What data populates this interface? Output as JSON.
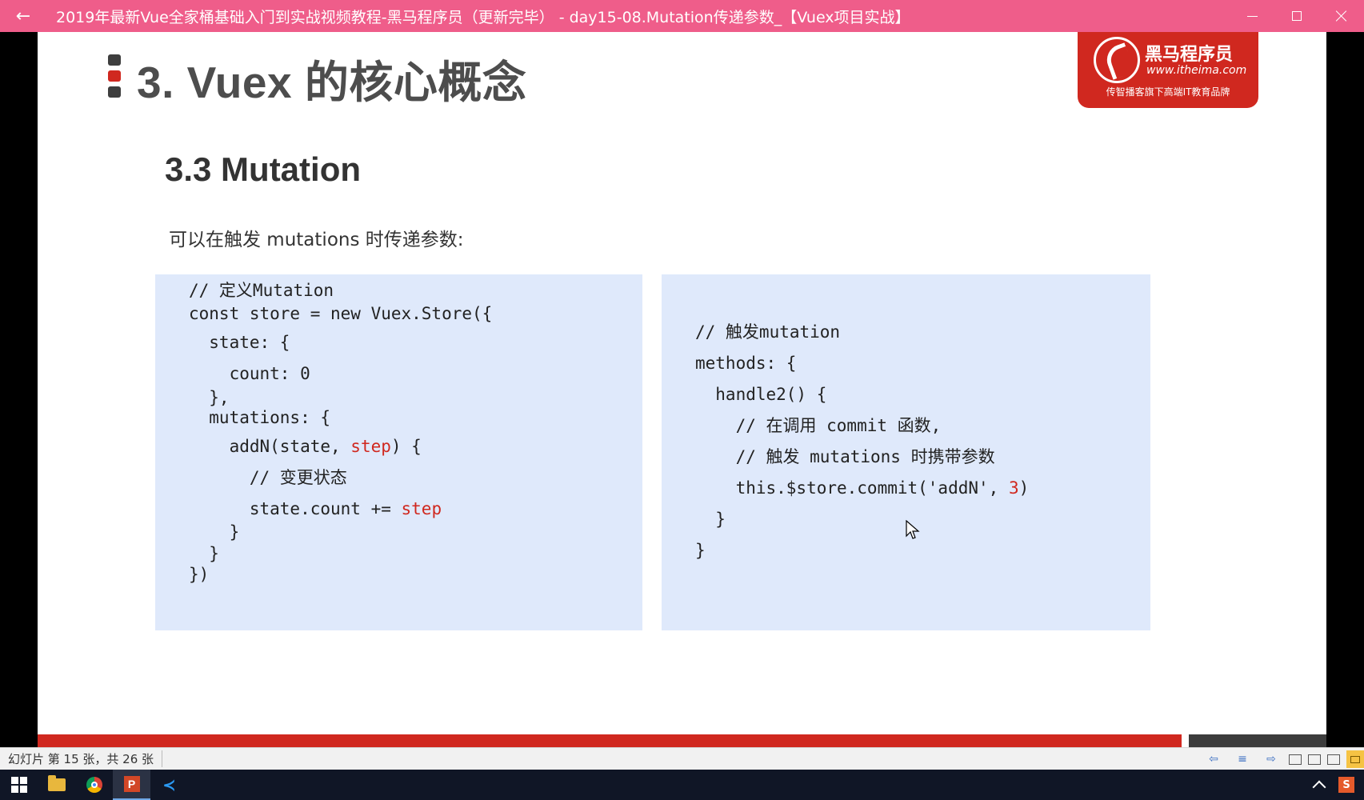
{
  "window": {
    "back_glyph": "←",
    "title": "2019年最新Vue全家桶基础入门到实战视频教程-黑马程序员（更新完毕） - day15-08.Mutation传递参数_【Vuex项目实战】",
    "accent_color": "#ef5d8a"
  },
  "slide": {
    "heading": "3. Vuex 的核心概念",
    "logo": {
      "name": "黑马程序员",
      "url": "www.itheima.com",
      "slogan": "传智播客旗下高端IT教育品牌"
    },
    "subtitle": "3.3 Mutation",
    "intro": "可以在触发 mutations 时传递参数:",
    "code_left": [
      "// 定义Mutation",
      "const store = new Vuex.Store({",
      "  state: {",
      "    count: 0",
      "  },",
      "  mutations: {",
      "    addN(state, ",
      "step",
      ") {",
      "      // 变更状态",
      "      state.count += ",
      "step",
      "    }",
      "  }",
      "})"
    ],
    "code_right": [
      "// 触发mutation",
      "methods: {",
      "  handle2() {",
      "    // 在调用 commit 函数,",
      "    // 触发 mutations 时携带参数",
      "    this.$store.commit('addN', ",
      "3",
      ")",
      "  }",
      "}"
    ],
    "highlight_color": "#d0281f",
    "code_bg_color": "#dfe9fb"
  },
  "statusbar": {
    "slide_info": "幻灯片 第 15 张，共 26 张",
    "prev_glyph": "⇦",
    "notes_glyph": "≡",
    "next_glyph": "⇨"
  },
  "taskbar": {
    "ppt_letter": "P",
    "vscode_glyph": "≺",
    "tray_letter": "S"
  }
}
